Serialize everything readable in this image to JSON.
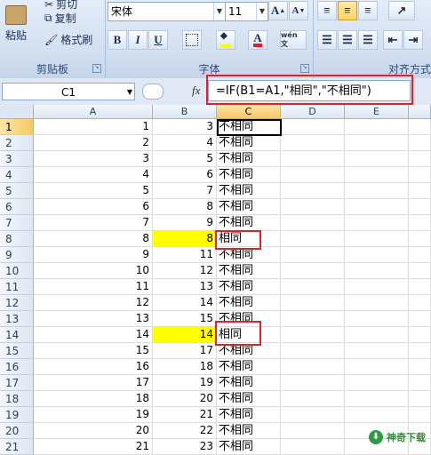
{
  "ribbon": {
    "clipboard": {
      "paste_label": "粘贴",
      "cut_label": "剪切",
      "copy_label": "复制",
      "format_painter_label": "格式刷",
      "group_label": "剪贴板"
    },
    "font": {
      "font_name": "宋体",
      "font_size": "11",
      "bold": "B",
      "italic": "I",
      "underline": "U",
      "grow_icon": "A",
      "shrink_icon": "A",
      "font_color_icon": "A",
      "wen_label": "wén 文",
      "group_label": "字体"
    },
    "alignment": {
      "group_label": "对齐方式"
    }
  },
  "formula_bar": {
    "name_box": "C1",
    "fx_label": "fx",
    "formula": "=IF(B1=A1,\"相同\",\"不相同\")"
  },
  "columns": [
    "A",
    "B",
    "C",
    "D",
    "E"
  ],
  "rows": [
    {
      "num": "1",
      "a": "1",
      "b": "3",
      "c": "不相同"
    },
    {
      "num": "2",
      "a": "2",
      "b": "4",
      "c": "不相同"
    },
    {
      "num": "3",
      "a": "3",
      "b": "5",
      "c": "不相同"
    },
    {
      "num": "4",
      "a": "4",
      "b": "6",
      "c": "不相同"
    },
    {
      "num": "5",
      "a": "5",
      "b": "7",
      "c": "不相同"
    },
    {
      "num": "6",
      "a": "6",
      "b": "8",
      "c": "不相同"
    },
    {
      "num": "7",
      "a": "7",
      "b": "9",
      "c": "不相同"
    },
    {
      "num": "8",
      "a": "8",
      "b": "8",
      "c": "相同"
    },
    {
      "num": "9",
      "a": "9",
      "b": "11",
      "c": "不相同"
    },
    {
      "num": "10",
      "a": "10",
      "b": "12",
      "c": "不相同"
    },
    {
      "num": "11",
      "a": "11",
      "b": "13",
      "c": "不相同"
    },
    {
      "num": "12",
      "a": "12",
      "b": "14",
      "c": "不相同"
    },
    {
      "num": "13",
      "a": "13",
      "b": "15",
      "c": "不相同"
    },
    {
      "num": "14",
      "a": "14",
      "b": "14",
      "c": "相同"
    },
    {
      "num": "15",
      "a": "15",
      "b": "17",
      "c": "不相同"
    },
    {
      "num": "16",
      "a": "16",
      "b": "18",
      "c": "不相同"
    },
    {
      "num": "17",
      "a": "17",
      "b": "19",
      "c": "不相同"
    },
    {
      "num": "18",
      "a": "18",
      "b": "20",
      "c": "不相同"
    },
    {
      "num": "19",
      "a": "19",
      "b": "21",
      "c": "不相同"
    },
    {
      "num": "20",
      "a": "20",
      "b": "22",
      "c": "不相同"
    },
    {
      "num": "21",
      "a": "21",
      "b": "23",
      "c": "不相同"
    }
  ],
  "highlight_color": "#ffff00",
  "annotation_color": "#e3202a",
  "watermark": {
    "text": "神奇下载"
  }
}
